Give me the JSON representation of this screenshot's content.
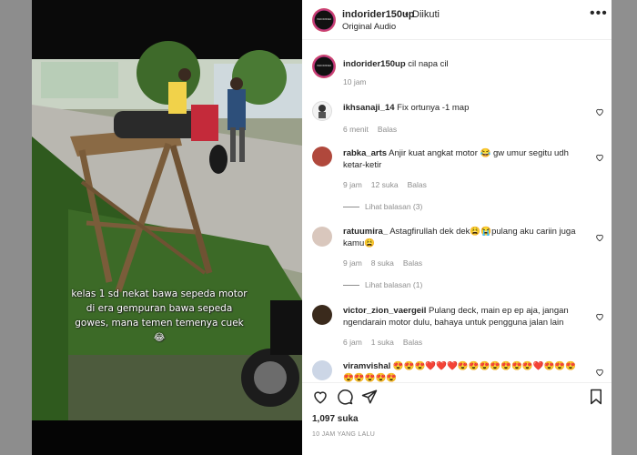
{
  "post": {
    "username": "indorider150up",
    "dot": "•",
    "follow_status": "Diikuti",
    "audio": "Original Audio",
    "avatar_text": "INDORIDER150UP",
    "more_icon": "more-horizontal-icon"
  },
  "caption_comment": {
    "username": "indorider150up",
    "text": " cil napa cil",
    "time": "10 jam"
  },
  "video": {
    "overlay_text": "kelas 1 sd nekat bawa sepeda motor di era gempuran bawa sepeda gowes, mana temen temenya cuek 😂"
  },
  "comments": [
    {
      "username": "ikhsanaji_14",
      "text": " Fix ortunya -1 map",
      "time": "6 menit",
      "reply_label": "Balas",
      "avatar_color": "#f4f4f4"
    },
    {
      "username": "rabka_arts",
      "text": " Anjir kuat angkat motor 😂 gw umur segitu udh ketar-ketir",
      "time": "9 jam",
      "likes": "12 suka",
      "reply_label": "Balas",
      "view_replies": "Lihat balasan (3)",
      "avatar_color": "#b0483c"
    },
    {
      "username": "ratuumira_",
      "text": " Astagfirullah dek dek😩😭pulang aku cariin juga kamu😩",
      "time": "9 jam",
      "likes": "8 suka",
      "reply_label": "Balas",
      "view_replies": "Lihat balasan (1)",
      "avatar_color": "#d9c7bd"
    },
    {
      "username": "victor_zion_vaergeil",
      "text": " Pulang deck, main ep ep aja, jangan ngendarain motor dulu, bahaya untuk pengguna jalan lain",
      "time": "6 jam",
      "likes": "1 suka",
      "reply_label": "Balas",
      "avatar_color": "#3a2a1c"
    },
    {
      "username": "viramvishal",
      "text": " 😍😍😍❤️❤️❤️😍😍😍😍😍😍😍❤️😍😍😍😍😍😍😍😍",
      "avatar_color": "#ccd6e6"
    }
  ],
  "actions": {
    "like_icon": "heart-icon",
    "comment_icon": "comment-icon",
    "share_icon": "share-icon",
    "save_icon": "bookmark-icon"
  },
  "likes_count": "1,097 suka",
  "posted_ago": "10 JAM YANG LALU"
}
